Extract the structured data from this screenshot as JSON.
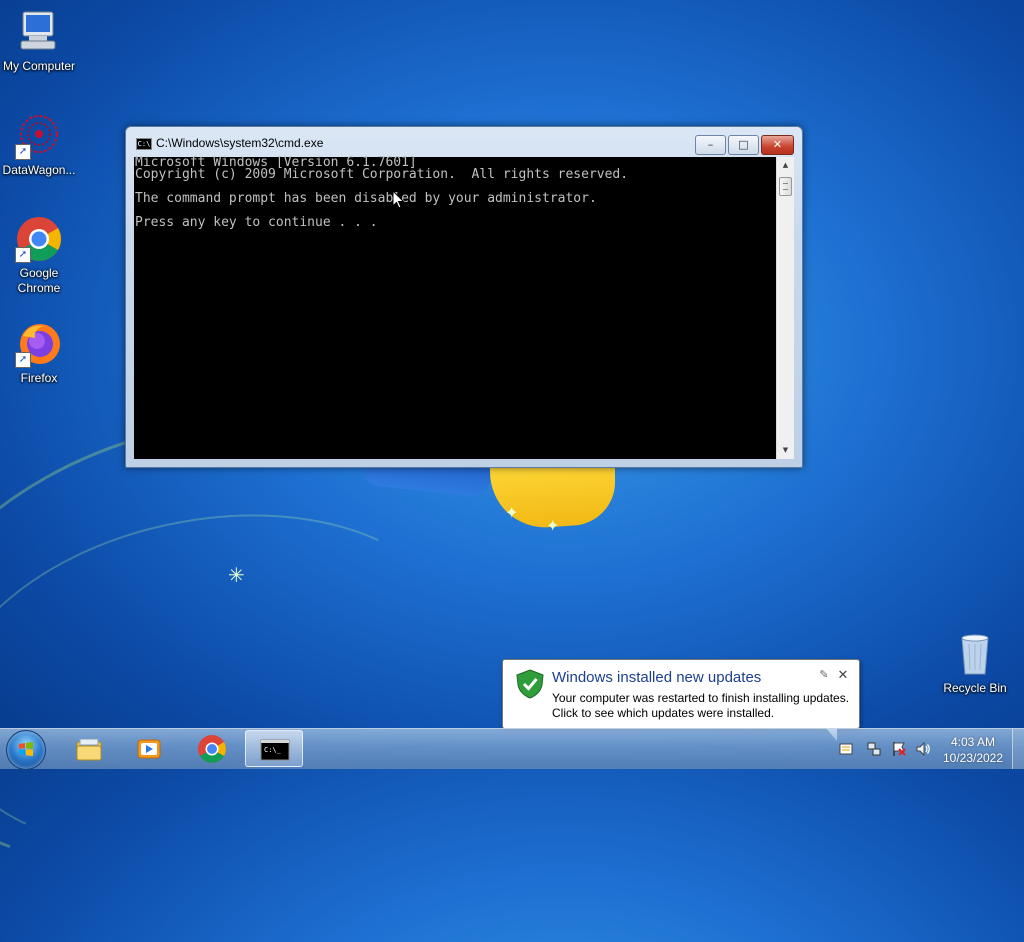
{
  "desktop": {
    "icons": [
      {
        "label": "My Computer",
        "icon": "computer-icon"
      },
      {
        "label": "DataWagon...",
        "icon": "datawagon-icon"
      },
      {
        "label_line1": "Google",
        "label_line2": "Chrome",
        "icon": "chrome-icon"
      },
      {
        "label": "Firefox",
        "icon": "firefox-icon"
      },
      {
        "label": "Recycle Bin",
        "icon": "recycle-bin-icon"
      }
    ]
  },
  "cmd_window": {
    "title": "C:\\Windows\\system32\\cmd.exe",
    "icon_text": "C:\\",
    "lines": [
      "Microsoft Windows [Version 6.1.7601]",
      "Copyright (c) 2009 Microsoft Corporation.  All rights reserved.",
      "",
      "The command prompt has been disabled by your administrator.",
      "",
      "Press any key to continue . . ."
    ],
    "buttons": {
      "minimize": "–",
      "maximize": "□",
      "close": "✕"
    }
  },
  "notification": {
    "title": "Windows installed new updates",
    "line1": "Your computer was restarted to finish installing updates.",
    "line2": "Click to see which updates were installed.",
    "close": "✕",
    "pin": "✎"
  },
  "taskbar": {
    "pinned": [
      "explorer-icon",
      "media-player-icon",
      "chrome-icon",
      "cmd-icon"
    ],
    "clock": {
      "time": "4:03 AM",
      "date": "10/23/2022"
    },
    "tray": [
      "action-center-icon",
      "network-icon",
      "flag-icon",
      "volume-icon"
    ]
  },
  "colors": {
    "balloon_title": "#1b3f91",
    "console_bg": "#000000",
    "console_text": "#c0c0c0"
  }
}
